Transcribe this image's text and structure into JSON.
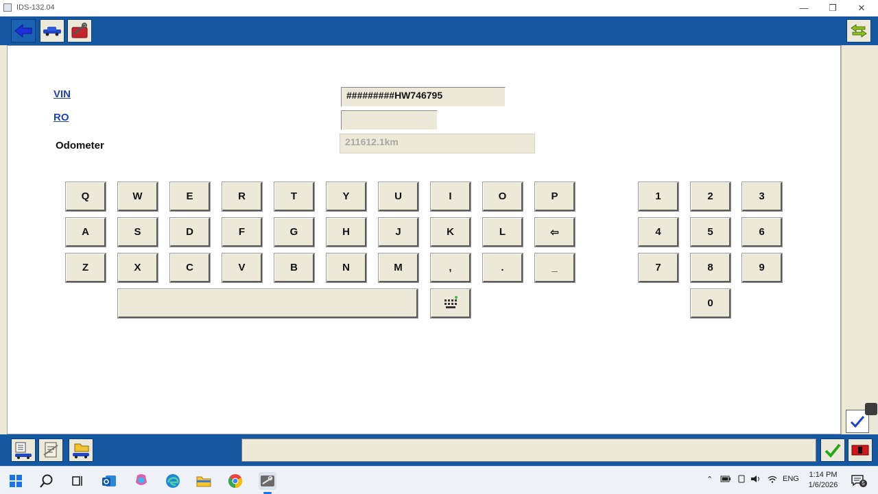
{
  "window": {
    "title": "IDS-132.04"
  },
  "form": {
    "vin_label": "VIN",
    "vin_value": "#########HW746795",
    "ro_label": "RO",
    "ro_value": "",
    "odometer_label": "Odometer",
    "odometer_value": "211612.1km"
  },
  "keyboard": {
    "row1": [
      "Q",
      "W",
      "E",
      "R",
      "T",
      "Y",
      "U",
      "I",
      "O",
      "P"
    ],
    "row2": [
      "A",
      "S",
      "D",
      "F",
      "G",
      "H",
      "J",
      "K",
      "L",
      "⇦"
    ],
    "row3": [
      "Z",
      "X",
      "C",
      "V",
      "B",
      "N",
      "M",
      ",",
      ".",
      "_"
    ],
    "num_row1": [
      "1",
      "2",
      "3"
    ],
    "num_row2": [
      "4",
      "5",
      "6"
    ],
    "num_row3": [
      "7",
      "8",
      "9"
    ],
    "num_zero": "0",
    "space_label": ""
  },
  "taskbar": {
    "language": "ENG",
    "time": "1:14 PM",
    "date": "1/6/2026",
    "notification_count": "5"
  },
  "colors": {
    "toolbar_blue": "#1557a0",
    "panel_beige": "#ece9d8",
    "link_blue": "#1f3fb5"
  }
}
